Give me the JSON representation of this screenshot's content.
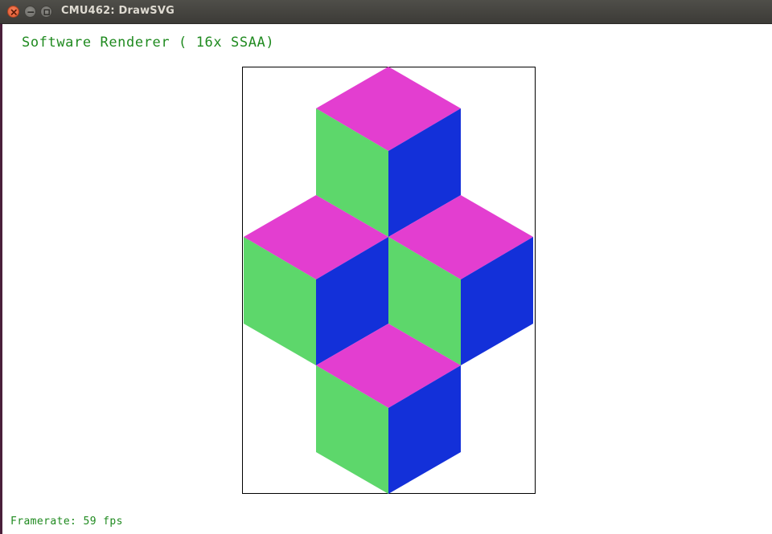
{
  "window": {
    "title": "CMU462: DrawSVG",
    "controls": {
      "close_icon": "close-icon",
      "minimize_icon": "minimize-icon",
      "maximize_icon": "maximize-icon"
    }
  },
  "overlay": {
    "renderer_label": "Software Renderer ( 16x SSAA)",
    "framerate_label": "Framerate: 59 fps",
    "text_color": "#1f8a1f"
  },
  "drawing": {
    "description": "isometric stacked cubes",
    "colors": {
      "top": "#e33ed0",
      "left": "#5dd76b",
      "right": "#1330d9",
      "frame": "#000000"
    },
    "cubes": [
      "top",
      "middle-left",
      "middle-right",
      "bottom"
    ]
  }
}
